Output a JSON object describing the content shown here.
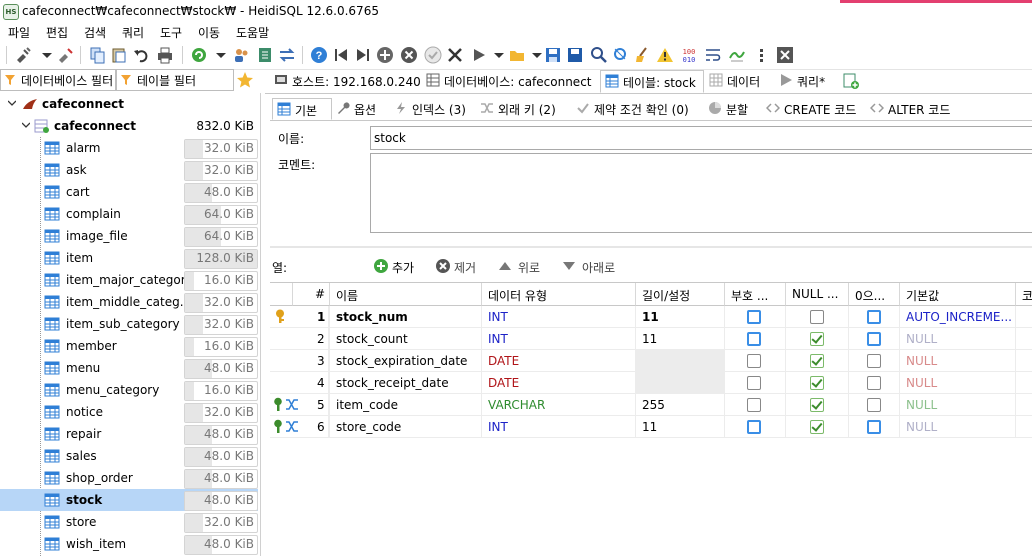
{
  "window": {
    "title": "cafeconnect₩cafeconnect₩stock₩ - HeidiSQL 12.6.0.6765",
    "app_icon_text": "HS"
  },
  "menu": [
    "파일",
    "편집",
    "검색",
    "쿼리",
    "도구",
    "이동",
    "도움말"
  ],
  "filters": {
    "db_filter": "데이터베이스 필터",
    "table_filter": "테이블 필터"
  },
  "main_tabs": [
    {
      "label": "호스트: 192.168.0.240"
    },
    {
      "label": "데이터베이스: cafeconnect"
    },
    {
      "label": "테이블: stock"
    },
    {
      "label": "데이터"
    },
    {
      "label": "쿼리*"
    }
  ],
  "tree": {
    "server": "cafeconnect",
    "database": {
      "name": "cafeconnect",
      "size": "832.0 KiB"
    },
    "tables": [
      {
        "name": "alarm",
        "size": "32.0 KiB",
        "fill": 0.25
      },
      {
        "name": "ask",
        "size": "32.0 KiB",
        "fill": 0.25
      },
      {
        "name": "cart",
        "size": "48.0 KiB",
        "fill": 0.375
      },
      {
        "name": "complain",
        "size": "64.0 KiB",
        "fill": 0.5
      },
      {
        "name": "image_file",
        "size": "64.0 KiB",
        "fill": 0.5
      },
      {
        "name": "item",
        "size": "128.0 KiB",
        "fill": 1.0
      },
      {
        "name": "item_major_category",
        "size": "16.0 KiB",
        "fill": 0.125
      },
      {
        "name": "item_middle_categ...",
        "size": "32.0 KiB",
        "fill": 0.25
      },
      {
        "name": "item_sub_category",
        "size": "32.0 KiB",
        "fill": 0.25
      },
      {
        "name": "member",
        "size": "16.0 KiB",
        "fill": 0.125
      },
      {
        "name": "menu",
        "size": "48.0 KiB",
        "fill": 0.375
      },
      {
        "name": "menu_category",
        "size": "16.0 KiB",
        "fill": 0.125
      },
      {
        "name": "notice",
        "size": "32.0 KiB",
        "fill": 0.25
      },
      {
        "name": "repair",
        "size": "48.0 KiB",
        "fill": 0.375
      },
      {
        "name": "sales",
        "size": "48.0 KiB",
        "fill": 0.375
      },
      {
        "name": "shop_order",
        "size": "48.0 KiB",
        "fill": 0.375
      },
      {
        "name": "stock",
        "size": "48.0 KiB",
        "fill": 0.375,
        "selected": true
      },
      {
        "name": "store",
        "size": "32.0 KiB",
        "fill": 0.25
      },
      {
        "name": "wish_item",
        "size": "48.0 KiB",
        "fill": 0.375
      }
    ]
  },
  "sub_tabs": [
    {
      "label": "기본"
    },
    {
      "label": "옵션"
    },
    {
      "label": "인덱스 (3)"
    },
    {
      "label": "외래 키 (2)"
    },
    {
      "label": "제약 조건 확인 (0)"
    },
    {
      "label": "분할"
    },
    {
      "label": "CREATE 코드"
    },
    {
      "label": "ALTER 코드"
    }
  ],
  "form": {
    "name_label": "이름:",
    "name_value": "stock",
    "comment_label": "코멘트:",
    "comment_value": ""
  },
  "columns_toolbar": {
    "label": "열:",
    "add": "추가",
    "remove": "제거",
    "up": "위로",
    "down": "아래로"
  },
  "grid": {
    "headers": [
      "#",
      "이름",
      "데이터 유형",
      "길이/설정",
      "부호 ...",
      "NULL ...",
      "0으...",
      "기본값",
      "코"
    ],
    "rows": [
      {
        "num": "1",
        "key": "primary",
        "name": "stock_num",
        "type": "INT",
        "type_color": "#1c22c7",
        "length": "11",
        "unsigned": "blue",
        "allow_null": "grey",
        "zerofill": "blue",
        "default": "AUTO_INCREME...",
        "default_color": "#1c22c7"
      },
      {
        "num": "2",
        "key": "",
        "name": "stock_count",
        "type": "INT",
        "type_color": "#1c22c7",
        "length": "11",
        "unsigned": "blue",
        "allow_null": "green",
        "zerofill": "blue",
        "default": "NULL",
        "default_color": "#b0b0c8"
      },
      {
        "num": "3",
        "key": "",
        "name": "stock_expiration_date",
        "type": "DATE",
        "type_color": "#b01418",
        "length": "",
        "unsigned": "grey",
        "allow_null": "green",
        "zerofill": "grey",
        "default": "NULL",
        "default_color": "#d88a8a"
      },
      {
        "num": "4",
        "key": "",
        "name": "stock_receipt_date",
        "type": "DATE",
        "type_color": "#b01418",
        "length": "",
        "unsigned": "grey",
        "allow_null": "green",
        "zerofill": "grey",
        "default": "NULL",
        "default_color": "#d88a8a"
      },
      {
        "num": "5",
        "key": "foreign",
        "name": "item_code",
        "type": "VARCHAR",
        "type_color": "#2e8b2e",
        "length": "255",
        "unsigned": "grey",
        "allow_null": "green",
        "zerofill": "grey",
        "default": "NULL",
        "default_color": "#8cc08c"
      },
      {
        "num": "6",
        "key": "foreign",
        "name": "store_code",
        "type": "INT",
        "type_color": "#1c22c7",
        "length": "11",
        "unsigned": "blue",
        "allow_null": "green",
        "zerofill": "blue",
        "default": "NULL",
        "default_color": "#b0b0c8"
      }
    ]
  },
  "colors": {
    "selection": "#b7d6f7",
    "primary_key": "#e0a11b",
    "foreign_key": "#3c8c2c"
  }
}
